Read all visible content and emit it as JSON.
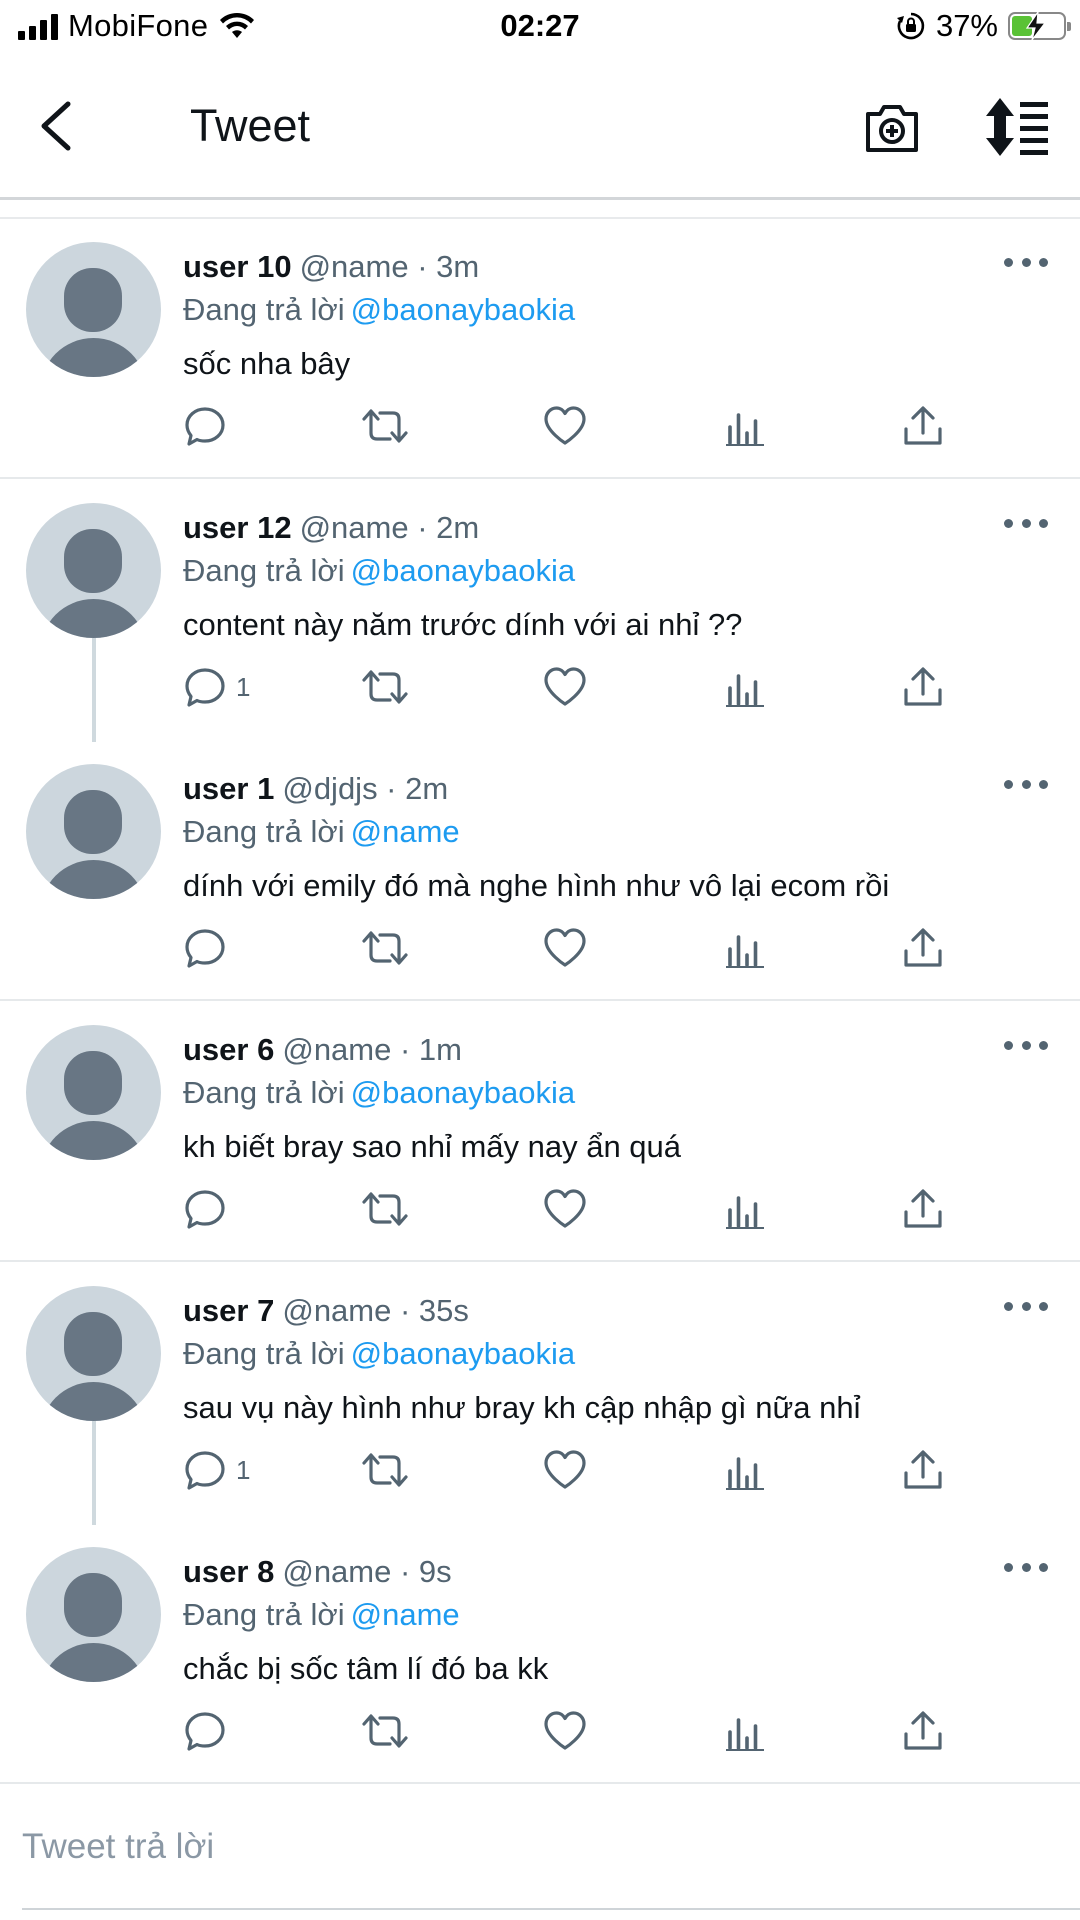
{
  "status_bar": {
    "carrier": "MobiFone",
    "time": "02:27",
    "battery": "37%",
    "battery_level": 0.37
  },
  "header": {
    "title": "Tweet",
    "back_icon": "chevron-left-icon",
    "camera_icon": "camera-plus-icon",
    "sort_icon": "sort-arrows-icon"
  },
  "reply_prefix": "Đang trả lời",
  "tweets": [
    {
      "user": "user 10",
      "handle": "@name · 3m",
      "mention": "@baonaybaokia",
      "text": "sốc nha bây",
      "reply_count": ""
    },
    {
      "user": "user 12",
      "handle": "@name · 2m",
      "mention": "@baonaybaokia",
      "text": "content này năm trước dính với ai nhỉ ??",
      "reply_count": "1"
    },
    {
      "user": "user 1",
      "handle": "@djdjs · 2m",
      "mention": "@name",
      "text": "dính với emily đó mà nghe hình như vô lại ecom rồi",
      "reply_count": ""
    },
    {
      "user": "user 6",
      "handle": "@name · 1m",
      "mention": "@baonaybaokia",
      "text": "kh biết bray sao nhỉ mấy nay ẩn quá",
      "reply_count": ""
    },
    {
      "user": "user 7",
      "handle": "@name · 35s",
      "mention": "@baonaybaokia",
      "text": "sau vụ này hình như bray kh cập nhập gì nữa nhỉ",
      "reply_count": "1"
    },
    {
      "user": "user 8",
      "handle": "@name · 9s",
      "mention": "@name",
      "text": "chắc bị sốc tâm lí đó ba kk",
      "reply_count": ""
    }
  ],
  "action_icons": [
    "reply-icon",
    "retweet-icon",
    "like-icon",
    "analytics-icon",
    "share-icon"
  ],
  "reply_bar": {
    "placeholder": "Tweet trả lời"
  },
  "colors": {
    "accent": "#1d9bf0",
    "text": "#0f1419",
    "secondary": "#536471",
    "avatar_bg": "#ccd6dd",
    "avatar_fg": "#687684",
    "battery": "#5ac236"
  }
}
